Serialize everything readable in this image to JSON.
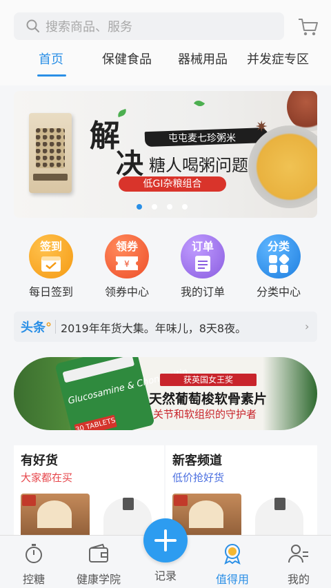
{
  "search": {
    "placeholder": "搜索商品、服务"
  },
  "tabs": [
    {
      "label": "首页",
      "active": true
    },
    {
      "label": "保健食品",
      "active": false
    },
    {
      "label": "器械用品",
      "active": false
    },
    {
      "label": "并发症专区",
      "active": false
    }
  ],
  "banner": {
    "brand": "屯屯麦七珍粥米",
    "big_char_1": "解",
    "big_char_2": "决",
    "subtitle": "糖人喝粥问题",
    "tagline": "低GI杂粮组合",
    "page_count": 4,
    "current_page": 1
  },
  "quick_actions": [
    {
      "tag": "签到",
      "label": "每日签到",
      "color": "#f5a524"
    },
    {
      "tag": "领券",
      "label": "领券中心",
      "color": "#f26a3a"
    },
    {
      "tag": "订单",
      "label": "我的订单",
      "color": "#9c6ee8"
    },
    {
      "tag": "分类",
      "label": "分类中心",
      "color": "#2a8fe6"
    }
  ],
  "headline": {
    "logo_main": "头条",
    "logo_mark": "°",
    "text": "2019年年货大集。年味儿，8天8夜。",
    "arrow": "›"
  },
  "promo": {
    "bottle_text": "Glucosamine & Chondroitin",
    "bottle_badge": "30 TABLETS",
    "award": "获英国女王奖",
    "title": "天然葡萄梭软骨素片",
    "subtitle": "关节和软组织的守护者"
  },
  "cards": [
    {
      "title": "有好货",
      "subtitle": "大家都在买",
      "subtitle_color": "#e6454a"
    },
    {
      "title": "新客频道",
      "subtitle": "低价抢好货",
      "subtitle_color": "#4b6fe0"
    }
  ],
  "bottom_nav": [
    {
      "label": "控糖",
      "icon": "stopwatch-icon",
      "active": false
    },
    {
      "label": "健康学院",
      "icon": "wallet-icon",
      "active": false
    },
    {
      "label": "记录",
      "icon": "plus-icon",
      "active": false
    },
    {
      "label": "值得用",
      "icon": "medal-icon",
      "active": true
    },
    {
      "label": "我的",
      "icon": "profile-icon",
      "active": false
    }
  ],
  "colors": {
    "accent": "#2a8fe6",
    "red": "#d9342b"
  }
}
